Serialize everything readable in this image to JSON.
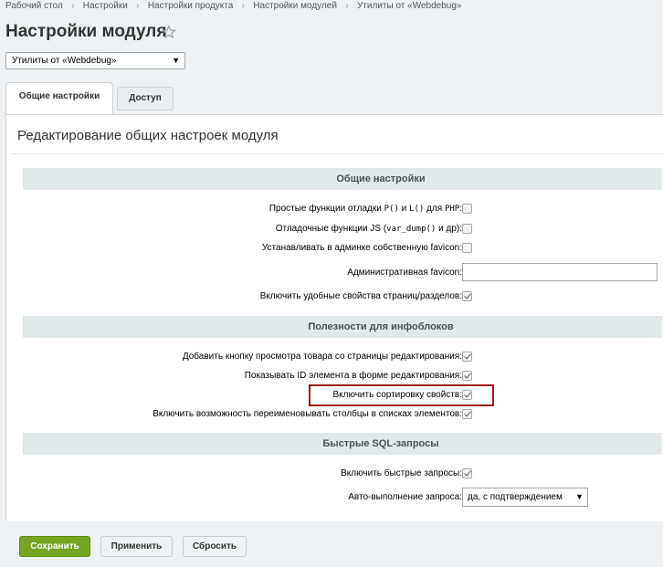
{
  "breadcrumb": [
    "Рабочий стол",
    "Настройки",
    "Настройки продукта",
    "Настройки модулей",
    "Утилиты от «Webdebug»"
  ],
  "page_title": "Настройки модуля",
  "module_select": {
    "value": "Утилиты от «Webdebug»"
  },
  "tabs": [
    "Общие настройки",
    "Доступ"
  ],
  "panel_heading": "Редактирование общих настроек модуля",
  "sections": {
    "general": {
      "title": "Общие настройки",
      "rows": [
        {
          "label_pre": "Простые функции отладки ",
          "code1": "P()",
          "mid": " и ",
          "code2": "L()",
          "mid2": " для ",
          "code3": "PHP",
          "post": ":",
          "checked": false
        },
        {
          "label_pre": "Отладочные функции JS (",
          "code1": "var_dump()",
          "post": " и др):",
          "checked": false
        },
        {
          "label": "Устанавливать в админке собственную favicon:",
          "checked": false
        },
        {
          "label": "Административная favicon:",
          "value": ""
        },
        {
          "label": "Включить удобные свойства страниц/разделов:",
          "checked": true
        }
      ]
    },
    "iblocks": {
      "title": "Полезности для инфоблоков",
      "rows": [
        {
          "label": "Добавить кнопку просмотра товара со страницы редактирования:",
          "checked": true
        },
        {
          "label": "Показывать ID элемента в форме редактирования:",
          "checked": true
        },
        {
          "label": "Включить сортировку свойств:",
          "checked": true
        },
        {
          "label": "Включить возможность переименовывать столбцы в списках элементов:",
          "checked": true
        }
      ]
    },
    "sql": {
      "title": "Быстрые SQL-запросы",
      "rows": [
        {
          "label": "Включить быстрые запросы:",
          "checked": true
        },
        {
          "label": "Авто-выполнение запроса:",
          "value": "да, с подтверждением"
        }
      ]
    }
  },
  "buttons": {
    "save": "Сохранить",
    "apply": "Применить",
    "reset": "Сбросить"
  },
  "colors": {
    "save": "#76a422",
    "section_bg": "#e0e8ea",
    "highlight": "#9b1c1c"
  }
}
